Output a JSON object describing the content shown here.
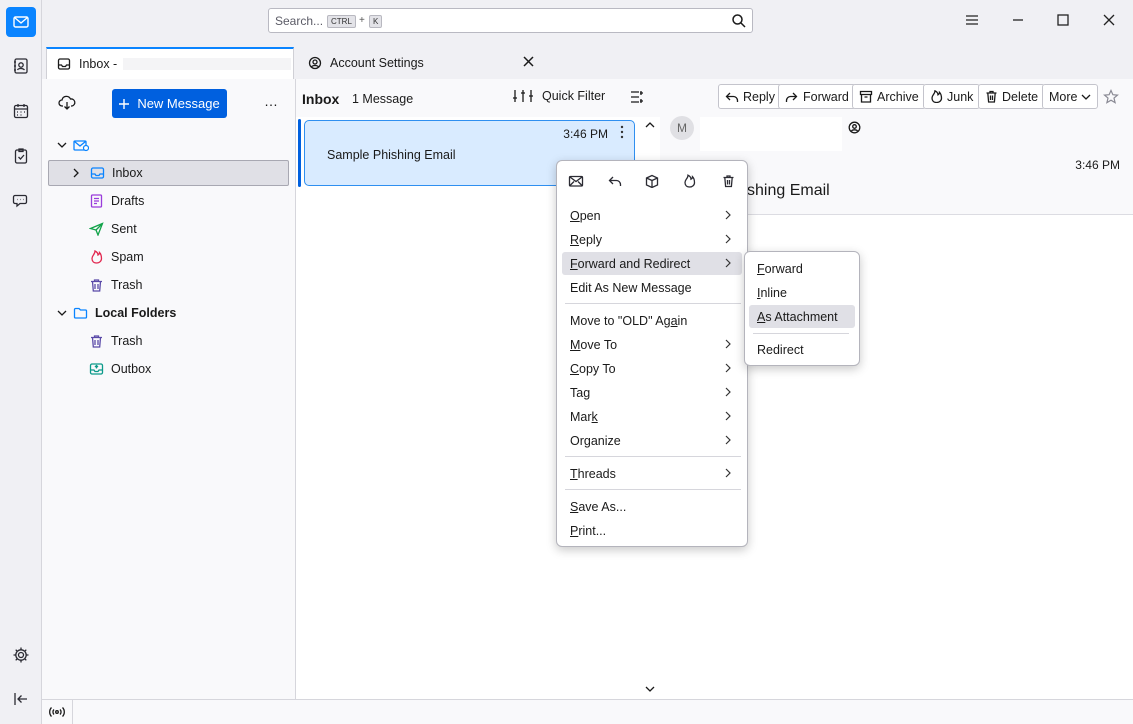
{
  "search": {
    "placeholder": "Search...",
    "key1": "CTRL",
    "plus": "+",
    "key2": "K"
  },
  "tabs": [
    {
      "label": "Inbox -",
      "selected": true
    },
    {
      "label": "Account Settings",
      "selected": false
    }
  ],
  "folder_pane": {
    "new_message": "New Message",
    "more": "…",
    "folders": [
      {
        "name": "Inbox",
        "icon": "inbox-icon",
        "selected": true
      },
      {
        "name": "Drafts",
        "icon": "drafts-icon"
      },
      {
        "name": "Sent",
        "icon": "sent-icon"
      },
      {
        "name": "Spam",
        "icon": "spam-icon"
      },
      {
        "name": "Trash",
        "icon": "trash-icon"
      }
    ],
    "local_folders": {
      "name": "Local Folders",
      "folders": [
        {
          "name": "Trash",
          "icon": "trash-icon"
        },
        {
          "name": "Outbox",
          "icon": "outbox-icon"
        }
      ]
    }
  },
  "thread_pane": {
    "title": "Inbox",
    "count": "1 Message",
    "quick_filter": "Quick Filter",
    "messages": [
      {
        "time": "3:46 PM",
        "subject": "Sample Phishing Email",
        "selected": true
      }
    ]
  },
  "reading_pane": {
    "buttons": [
      "Reply",
      "Forward",
      "Archive",
      "Junk",
      "Delete",
      "More"
    ],
    "avatar_letter": "M",
    "time": "3:46 PM",
    "subject_partial": "shing Email"
  },
  "context_menu": {
    "icons": [
      "mark-read-icon",
      "reply-icon",
      "archive-icon",
      "junk-icon",
      "delete-icon"
    ],
    "items": {
      "open": {
        "pre": "",
        "key": "O",
        "post": "pen"
      },
      "reply": {
        "pre": "",
        "key": "R",
        "post": "eply"
      },
      "forward_redirect": {
        "pre": "",
        "key": "F",
        "post": "orward and Redirect"
      },
      "edit_new": "Edit As New Message",
      "move_old": {
        "pre": "Move to \"OLD\" Ag",
        "key": "a",
        "post": "in"
      },
      "move_to": {
        "pre": "",
        "key": "M",
        "post": "ove To"
      },
      "copy_to": {
        "pre": "",
        "key": "C",
        "post": "opy To"
      },
      "tag": {
        "pre": "Ta",
        "key": "g",
        "post": ""
      },
      "mark": {
        "pre": "Mar",
        "key": "k",
        "post": ""
      },
      "organize": "Organize",
      "threads": {
        "pre": "",
        "key": "T",
        "post": "hreads"
      },
      "save_as": {
        "pre": "",
        "key": "S",
        "post": "ave As..."
      },
      "print": {
        "pre": "",
        "key": "P",
        "post": "rint..."
      }
    }
  },
  "submenu": {
    "forward": {
      "pre": "",
      "key": "F",
      "post": "orward"
    },
    "inline": {
      "pre": "",
      "key": "I",
      "post": "nline"
    },
    "as_attachment": {
      "pre": "",
      "key": "A",
      "post": "s Attachment"
    },
    "redirect": "Redirect"
  },
  "colors": {
    "accent": "#0060df",
    "selection": "#d9ebff",
    "selection_border": "#2f8ff0"
  }
}
